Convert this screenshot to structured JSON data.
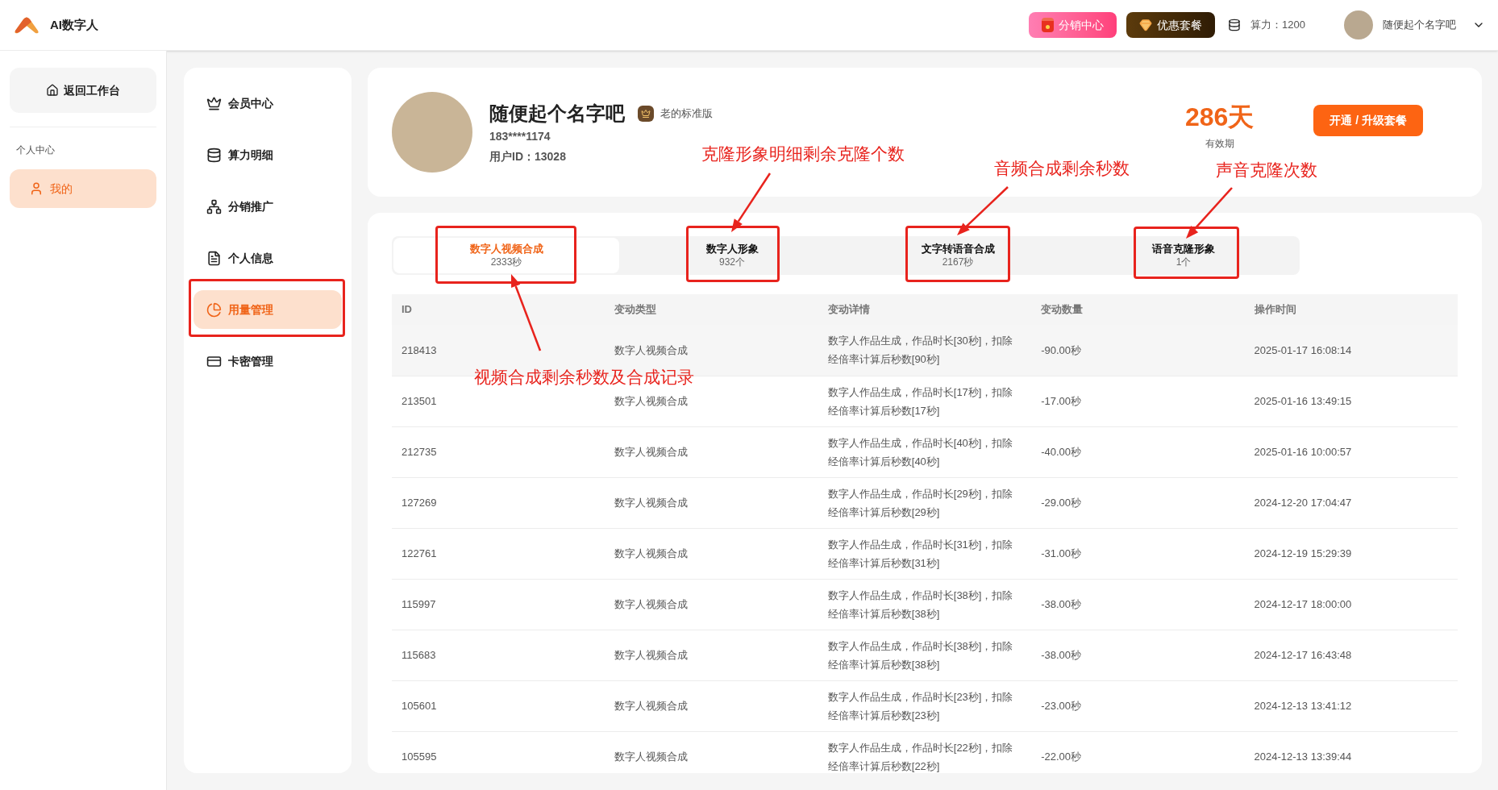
{
  "header": {
    "app_name": "AI数字人",
    "buttons": [
      {
        "label": "分销中心",
        "kind": "promo"
      },
      {
        "label": "优惠套餐",
        "kind": "package"
      }
    ],
    "credit": "算力：1200",
    "user_name": "随便起个名字吧"
  },
  "sidebar": {
    "back_button": "返回工作台",
    "section": "个人中心",
    "items": [
      {
        "label": "我的",
        "selected": true
      }
    ]
  },
  "menu": {
    "items": [
      {
        "label": "会员中心",
        "kind": "crown",
        "selected": false
      },
      {
        "label": "算力明细",
        "kind": "coins",
        "selected": false
      },
      {
        "label": "分销推广",
        "kind": "network",
        "selected": false
      },
      {
        "label": "个人信息",
        "kind": "profile",
        "selected": false
      },
      {
        "label": "用量管理",
        "kind": "pie",
        "selected": true
      },
      {
        "label": "卡密管理",
        "kind": "card",
        "selected": false
      }
    ]
  },
  "profile": {
    "name": "随便起个名字吧",
    "badge": "老的标准版",
    "phone": "183****1174",
    "user_id": "用户ID：13028",
    "validity": "286天",
    "validity_label": "有效期",
    "upgrade_button": "开通 / 升级套餐"
  },
  "usage_tabs": [
    {
      "label": "数字人视频合成",
      "value": "2333秒",
      "selected": true
    },
    {
      "label": "数字人形象",
      "value": "932个",
      "selected": false
    },
    {
      "label": "文字转语音合成",
      "value": "2167秒",
      "selected": false
    },
    {
      "label": "语音克隆形象",
      "value": "1个",
      "selected": false
    }
  ],
  "table": {
    "columns": [
      "ID",
      "变动类型",
      "变动详情",
      "变动数量",
      "操作时间"
    ],
    "rows": [
      [
        "218413",
        "数字人视频合成",
        "数字人作品生成，作品时长[30秒]，扣除经倍率计算后秒数[90秒]",
        "-90.00秒",
        "2025-01-17 16:08:14"
      ],
      [
        "213501",
        "数字人视频合成",
        "数字人作品生成，作品时长[17秒]，扣除经倍率计算后秒数[17秒]",
        "-17.00秒",
        "2025-01-16 13:49:15"
      ],
      [
        "212735",
        "数字人视频合成",
        "数字人作品生成，作品时长[40秒]，扣除经倍率计算后秒数[40秒]",
        "-40.00秒",
        "2025-01-16 10:00:57"
      ],
      [
        "127269",
        "数字人视频合成",
        "数字人作品生成，作品时长[29秒]，扣除经倍率计算后秒数[29秒]",
        "-29.00秒",
        "2024-12-20 17:04:47"
      ],
      [
        "122761",
        "数字人视频合成",
        "数字人作品生成，作品时长[31秒]，扣除经倍率计算后秒数[31秒]",
        "-31.00秒",
        "2024-12-19 15:29:39"
      ],
      [
        "115997",
        "数字人视频合成",
        "数字人作品生成，作品时长[38秒]，扣除经倍率计算后秒数[38秒]",
        "-38.00秒",
        "2024-12-17 18:00:00"
      ],
      [
        "115683",
        "数字人视频合成",
        "数字人作品生成，作品时长[38秒]，扣除经倍率计算后秒数[38秒]",
        "-38.00秒",
        "2024-12-17 16:43:48"
      ],
      [
        "105601",
        "数字人视频合成",
        "数字人作品生成，作品时长[23秒]，扣除经倍率计算后秒数[23秒]",
        "-23.00秒",
        "2024-12-13 13:41:12"
      ],
      [
        "105595",
        "数字人视频合成",
        "数字人作品生成，作品时长[22秒]，扣除经倍率计算后秒数[22秒]",
        "-22.00秒",
        "2024-12-13 13:39:44"
      ]
    ]
  },
  "annotations": [
    {
      "text": "克隆形象明细剩余克隆个数"
    },
    {
      "text": "音频合成剩余秒数"
    },
    {
      "text": "声音克隆次数"
    },
    {
      "text": "视频合成剩余秒数及合成记录"
    }
  ]
}
